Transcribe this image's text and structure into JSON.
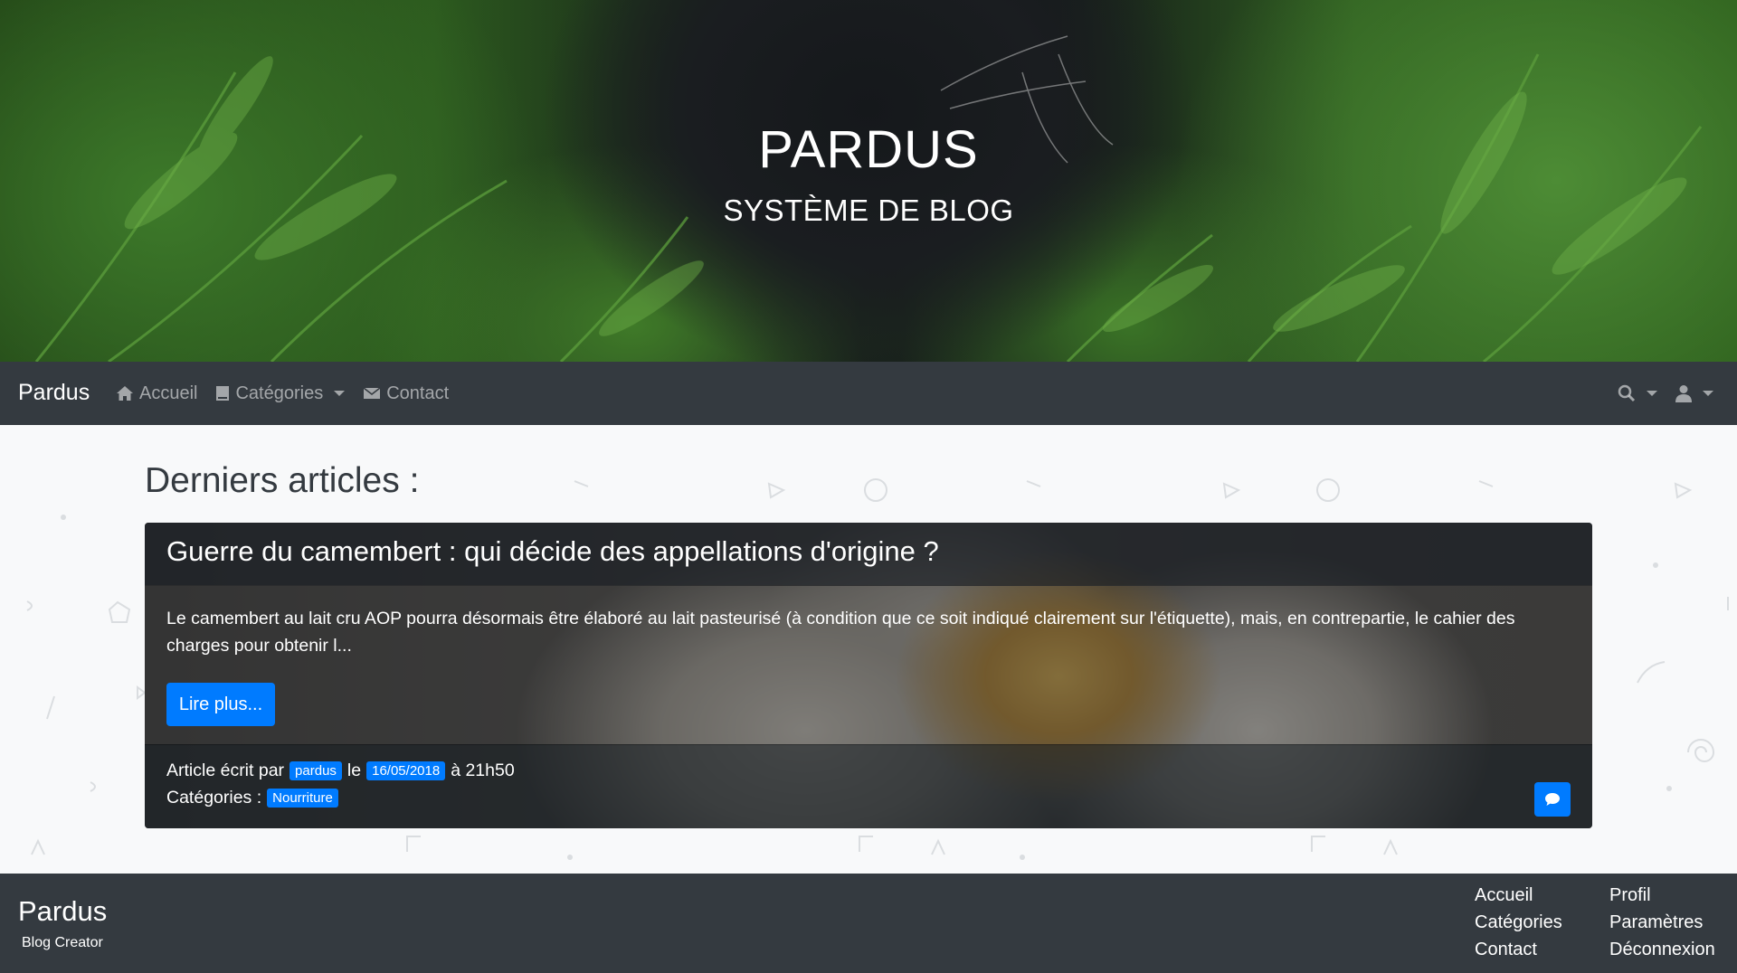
{
  "hero": {
    "title": "PARDUS",
    "subtitle": "SYSTÈME DE BLOG"
  },
  "navbar": {
    "brand": "Pardus",
    "items": [
      {
        "label": "Accueil",
        "icon": "home-icon"
      },
      {
        "label": "Catégories",
        "icon": "book-icon",
        "dropdown": true
      },
      {
        "label": "Contact",
        "icon": "envelope-icon"
      }
    ],
    "right": [
      {
        "icon": "search-icon",
        "dropdown": true
      },
      {
        "icon": "user-icon",
        "dropdown": true
      }
    ]
  },
  "main": {
    "section_title": "Derniers articles :",
    "article": {
      "title": "Guerre du camembert : qui décide des appellations d'origine ?",
      "excerpt": "Le camembert au lait cru AOP pourra désormais être élaboré au lait pasteurisé (à condition que ce soit indiqué clairement sur l'étiquette), mais, en contrepartie, le cahier des charges pour obtenir l...",
      "read_more_label": "Lire plus...",
      "meta_written_by": "Article écrit par",
      "author": "pardus",
      "meta_on": "le",
      "date": "16/05/2018",
      "time": "à 21h50",
      "categories_label": "Catégories :",
      "category": "Nourriture",
      "comment_icon": "comment-icon"
    }
  },
  "footer": {
    "brand": "Pardus",
    "tagline": "Blog Creator",
    "col1": [
      "Accueil",
      "Catégories",
      "Contact"
    ],
    "col2": [
      "Profil",
      "Paramètres",
      "Déconnexion"
    ]
  },
  "colors": {
    "navbar_bg": "#343a40",
    "primary": "#007bff",
    "page_bg": "#f8f9fa"
  }
}
